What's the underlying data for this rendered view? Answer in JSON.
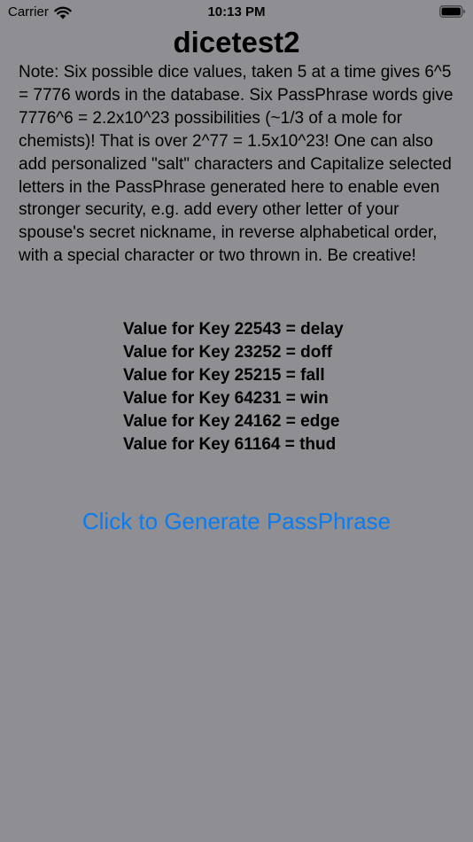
{
  "status_bar": {
    "carrier": "Carrier",
    "time": "10:13 PM",
    "icons": [
      "wifi-icon",
      "battery-icon"
    ]
  },
  "app": {
    "title": "dicetest2",
    "note": "Note: Six possible dice values, taken 5 at a time gives 6^5 = 7776 words in the database. Six PassPhrase words give 7776^6 = 2.2x10^23 possibilities (~1/3 of a mole for chemists)! That is over 2^77 = 1.5x10^23! One can also add personalized \"salt\" characters and Capitalize selected letters in the PassPhrase generated here to enable even stronger security, e.g. add every other letter of your spouse's secret nickname, in reverse alphabetical order, with a special character or two thrown in. Be creative!",
    "values": [
      "Value for Key 22543 = delay",
      "Value for Key 23252 = doff",
      "Value for Key 25215 = fall",
      "Value for Key 64231 = win",
      "Value for Key 24162 = edge",
      "Value for Key 61164 = thud"
    ],
    "generate_button_label": "Click to Generate PassPhrase"
  },
  "colors": {
    "background": "#8e8e93",
    "text": "#000000",
    "accent": "#0a7cf2"
  }
}
